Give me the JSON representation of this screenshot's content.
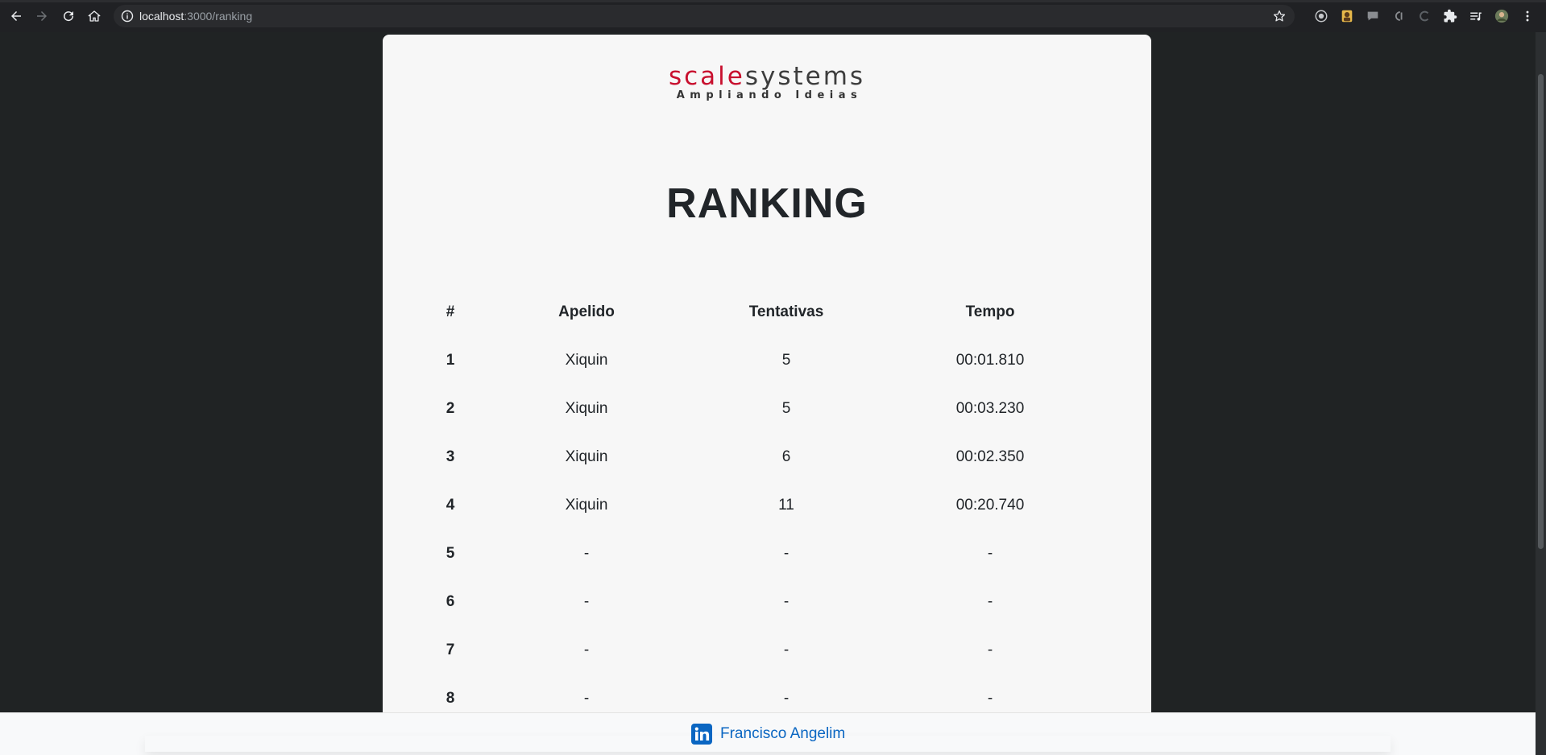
{
  "browser": {
    "url_host": "localhost",
    "url_rest": ":3000/ranking",
    "icons": [
      "back-icon",
      "forward-icon",
      "reload-icon",
      "home-icon",
      "info-icon",
      "bookmark-star-icon",
      "extensions-icon",
      "reading-list-icon",
      "profile-avatar",
      "menu-icon"
    ]
  },
  "logo": {
    "scale": "scale",
    "systems": "systems",
    "tagline": "Ampliando Ideias"
  },
  "page": {
    "title": "RANKING"
  },
  "table": {
    "headers": [
      "#",
      "Apelido",
      "Tentativas",
      "Tempo"
    ],
    "rows": [
      {
        "pos": "1",
        "nick": "Xiquin",
        "tries": "5",
        "time": "00:01.810"
      },
      {
        "pos": "2",
        "nick": "Xiquin",
        "tries": "5",
        "time": "00:03.230"
      },
      {
        "pos": "3",
        "nick": "Xiquin",
        "tries": "6",
        "time": "00:02.350"
      },
      {
        "pos": "4",
        "nick": "Xiquin",
        "tries": "11",
        "time": "00:20.740"
      },
      {
        "pos": "5",
        "nick": "-",
        "tries": "-",
        "time": "-"
      },
      {
        "pos": "6",
        "nick": "-",
        "tries": "-",
        "time": "-"
      },
      {
        "pos": "7",
        "nick": "-",
        "tries": "-",
        "time": "-"
      },
      {
        "pos": "8",
        "nick": "-",
        "tries": "-",
        "time": "-"
      }
    ]
  },
  "footer": {
    "author": "Francisco Angelim",
    "icon": "linkedin-icon"
  },
  "colors": {
    "page_background": "#202324",
    "card_background": "#f7f7f7",
    "brand_red": "#c8102e",
    "link_blue": "#0a66c2"
  }
}
